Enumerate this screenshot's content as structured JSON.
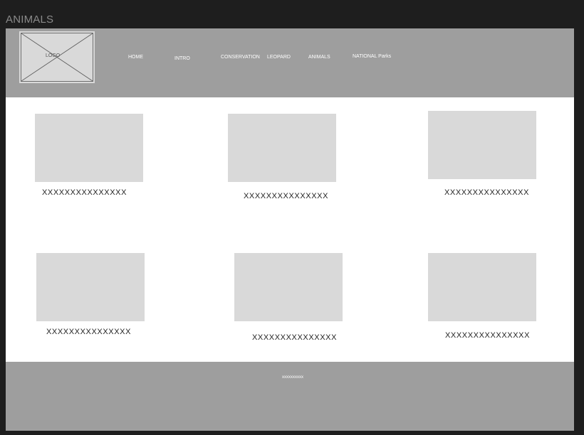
{
  "canvas": {
    "title": "ANIMALS"
  },
  "header": {
    "logo_label": "LOGO",
    "nav": {
      "home": "HOME",
      "intro": "INTRO",
      "conservation": "CONSERVATION",
      "leopard": "LEOPARD",
      "animals": "ANIMALS",
      "national_parks": "NATIONAL Parks"
    }
  },
  "cards": [
    {
      "caption": "XXXXXXXXXXXXXXX"
    },
    {
      "caption": "XXXXXXXXXXXXXXX"
    },
    {
      "caption": "XXXXXXXXXXXXXXX"
    },
    {
      "caption": "XXXXXXXXXXXXXXX"
    },
    {
      "caption": "XXXXXXXXXXXXXXX"
    },
    {
      "caption": "XXXXXXXXXXXXXXX"
    }
  ],
  "footer": {
    "text": "xxxxxxxxxx"
  },
  "colors": {
    "background": "#1e1e1e",
    "header_footer": "#9e9e9e",
    "placeholder": "#d9d9d9",
    "page": "#ffffff"
  }
}
